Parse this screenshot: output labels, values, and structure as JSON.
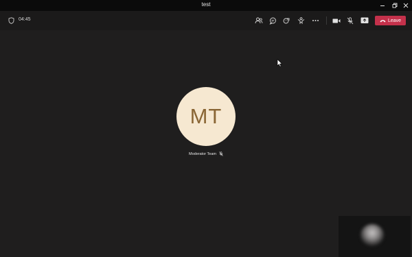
{
  "window": {
    "title": "test",
    "controls": [
      "minimize-icon",
      "restore-icon",
      "close-icon"
    ]
  },
  "toolbar": {
    "timer": "04:45",
    "left_icon": "shield-icon",
    "actions": [
      "people-icon",
      "chat-icon",
      "react-icon",
      "rooms-icon",
      "more-icon"
    ],
    "media": [
      "camera-icon",
      "mic-muted-icon",
      "share-icon"
    ],
    "leave_label": "Leave",
    "leave_color": "#c4314b"
  },
  "stage": {
    "avatar_initials": "MT",
    "avatar_bg": "#f6e8d1",
    "avatar_fg": "#8a6635",
    "participant_name": "Moderator Team",
    "participant_status_icon": "mic-muted-icon"
  }
}
